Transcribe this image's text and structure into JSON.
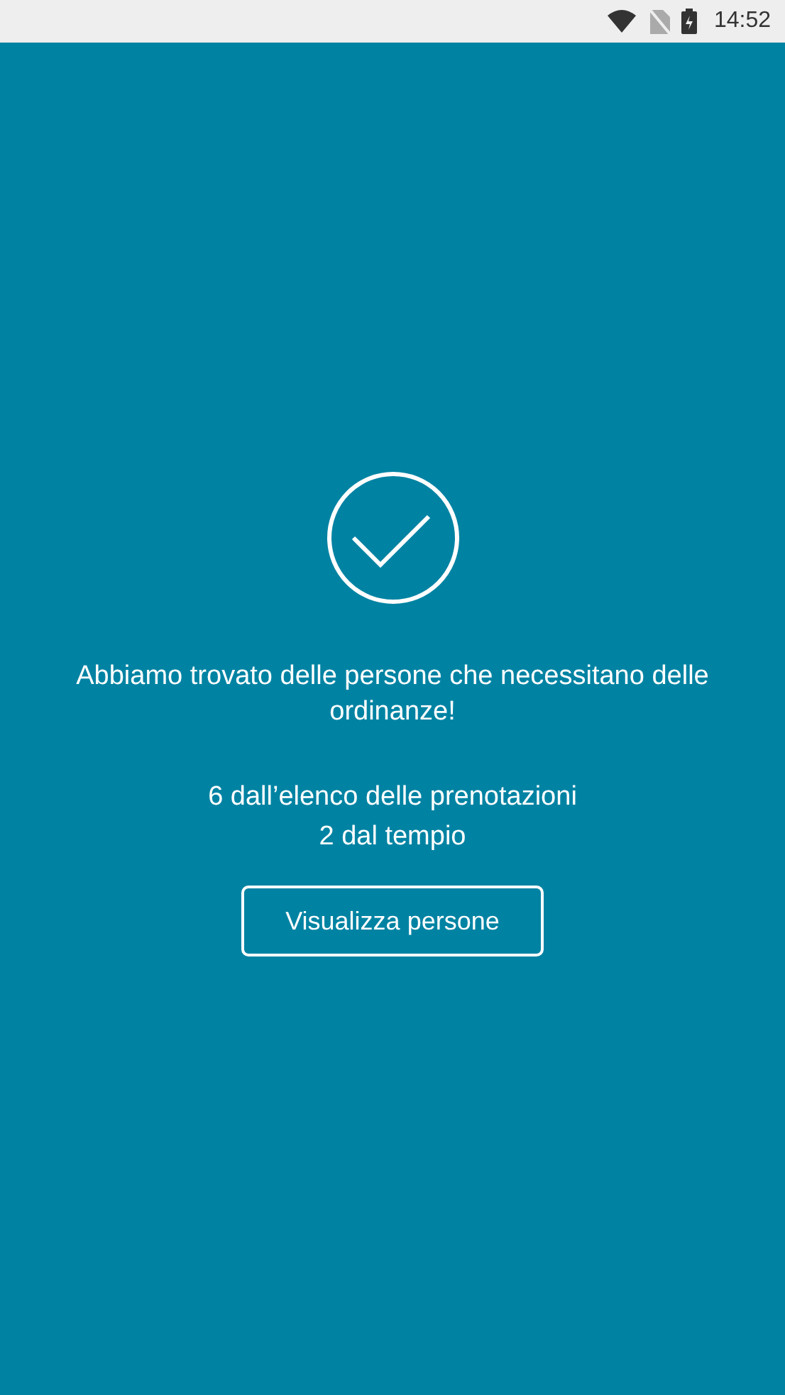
{
  "status_bar": {
    "time": "14:52"
  },
  "message": "Abbiamo trovato delle persone che necessitano delle ordinanze!",
  "stats": [
    "6 dall’elenco delle prenotazioni",
    "2 dal tempio"
  ],
  "button": {
    "label": "Visualizza persone"
  }
}
